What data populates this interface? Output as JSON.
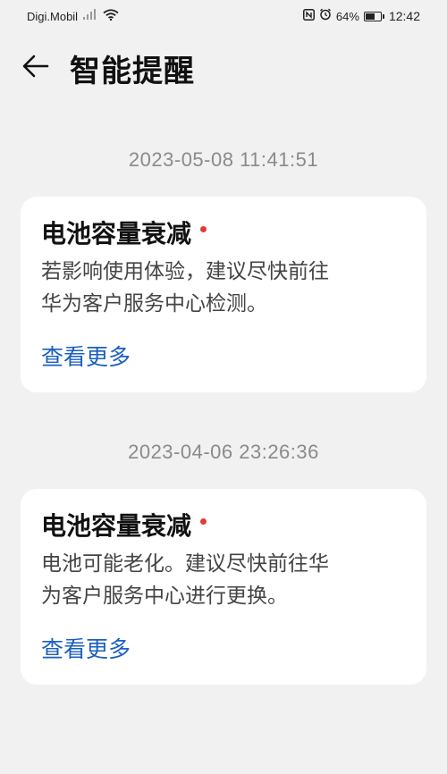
{
  "status_bar": {
    "carrier": "Digi.Mobil",
    "battery_percent": "64%",
    "battery_level": 0.64,
    "time": "12:42",
    "icons": [
      "signal-icon",
      "wifi-icon",
      "nfc-icon",
      "alarm-icon",
      "battery-icon"
    ]
  },
  "header": {
    "title": "智能提醒"
  },
  "notifications": [
    {
      "timestamp": "2023-05-08 11:41:51",
      "title": "电池容量衰减",
      "body_line1": "若影响使用体验，建议尽快前往",
      "body_line2": "华为客户服务中心检测。",
      "link": "查看更多"
    },
    {
      "timestamp": "2023-04-06 23:26:36",
      "title": "电池容量衰减",
      "body_line1": "电池可能老化。建议尽快前往华",
      "body_line2": "为客户服务中心进行更换。",
      "link": "查看更多"
    }
  ],
  "colors": {
    "background": "#f1f1f1",
    "card": "#ffffff",
    "link": "#1a5fbf",
    "unread_dot": "#e53935",
    "timestamp": "#8a8a8a"
  }
}
